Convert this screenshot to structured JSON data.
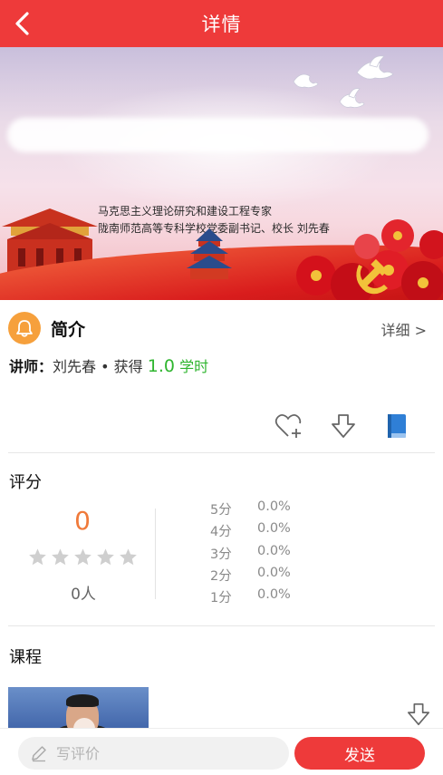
{
  "header": {
    "title": "详情"
  },
  "banner": {
    "caption_line1": "马克思主义理论研究和建设工程专家",
    "caption_line2": "陇南师范高等专科学校党委副书记、校长    刘先春"
  },
  "intro": {
    "title": "简介",
    "detail_link": "详细 >",
    "lecturer_label": "讲师：",
    "lecturer_name": "刘先春",
    "separator": " • ",
    "earn_text": "获得",
    "hours_value": "1.0",
    "hours_unit": "学时"
  },
  "rating": {
    "section_title": "评分",
    "score": "0",
    "people": "0人",
    "stars_filled": 0,
    "stars_total": 5,
    "distribution": [
      {
        "level": "5分",
        "percent": "0.0%"
      },
      {
        "level": "4分",
        "percent": "0.0%"
      },
      {
        "level": "3分",
        "percent": "0.0%"
      },
      {
        "level": "2分",
        "percent": "0.0%"
      },
      {
        "level": "1分",
        "percent": "0.0%"
      }
    ]
  },
  "course": {
    "section_title": "课程"
  },
  "comment": {
    "placeholder": "写评价",
    "send_label": "发送"
  },
  "colors": {
    "brand_red": "#ee3a3a",
    "score_orange": "#f07a3a",
    "hours_green": "#2fb52f",
    "bell_orange": "#f6a03c",
    "book_blue": "#2f7fd6"
  }
}
